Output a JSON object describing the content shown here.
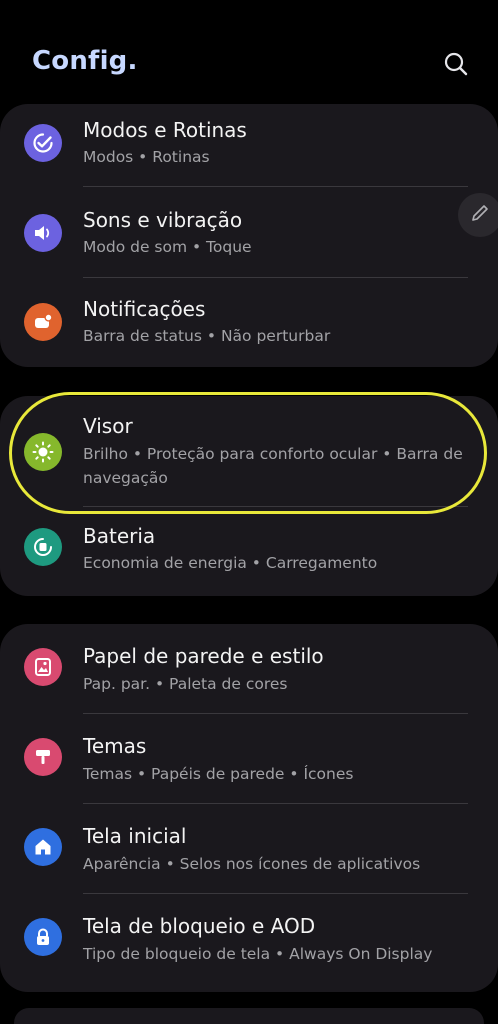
{
  "header": {
    "title": "Config.",
    "search_icon": "search-icon"
  },
  "colors": {
    "background": "#000000",
    "card": "#1a181d",
    "title": "#c7d8ff",
    "highlight": "#e8e83a"
  },
  "groups": [
    {
      "items": [
        {
          "label": "Modos e Rotinas",
          "sub": "Modos  •  Rotinas",
          "icon": "check-circle-icon",
          "color": "#6c62e0"
        },
        {
          "label": "Sons e vibração",
          "sub": "Modo de som  •  Toque",
          "icon": "speaker-icon",
          "color": "#6c62e0"
        },
        {
          "label": "Notificações",
          "sub": "Barra de status  •  Não perturbar",
          "icon": "notification-icon",
          "color": "#e0632e"
        }
      ]
    },
    {
      "items": [
        {
          "label": "Visor",
          "sub": "Brilho  •  Proteção para conforto ocular  •  Barra de navegação",
          "icon": "sun-icon",
          "color": "#86b82c"
        },
        {
          "label": "Bateria",
          "sub": "Economia de energia  •  Carregamento",
          "icon": "battery-icon",
          "color": "#1e9a80"
        }
      ]
    },
    {
      "items": [
        {
          "label": "Papel de parede e estilo",
          "sub": "Pap. par.  •  Paleta de cores",
          "icon": "wallpaper-icon",
          "color": "#d94a70"
        },
        {
          "label": "Temas",
          "sub": "Temas  •  Papéis de parede  •  Ícones",
          "icon": "theme-brush-icon",
          "color": "#d94a70"
        },
        {
          "label": "Tela inicial",
          "sub": "Aparência  •  Selos nos ícones de aplicativos",
          "icon": "home-icon",
          "color": "#2f6fe0"
        },
        {
          "label": "Tela de bloqueio e AOD",
          "sub": "Tipo de bloqueio de tela  •  Always On Display",
          "icon": "lock-icon",
          "color": "#2f6fe0"
        }
      ]
    }
  ],
  "fab": {
    "icon": "pencil-icon"
  }
}
